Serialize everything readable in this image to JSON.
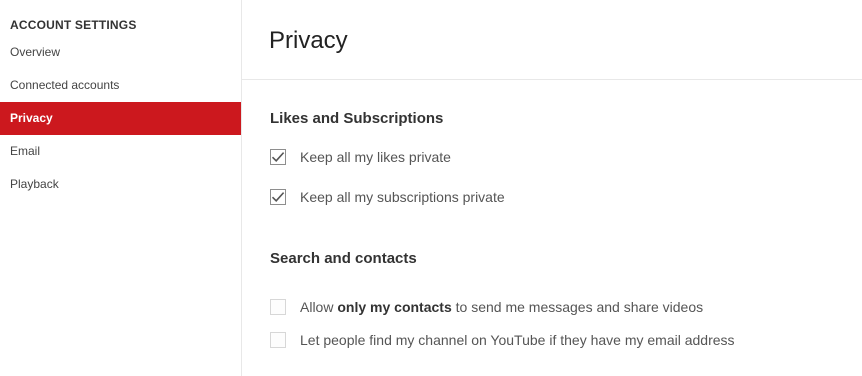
{
  "sidebar": {
    "heading": "ACCOUNT SETTINGS",
    "items": [
      {
        "label": "Overview",
        "active": false
      },
      {
        "label": "Connected accounts",
        "active": false
      },
      {
        "label": "Privacy",
        "active": true
      },
      {
        "label": "Email",
        "active": false
      },
      {
        "label": "Playback",
        "active": false
      }
    ]
  },
  "main": {
    "title": "Privacy",
    "sections": [
      {
        "title": "Likes and Subscriptions",
        "options": [
          {
            "label": "Keep all my likes private",
            "checked": true
          },
          {
            "label": "Keep all my subscriptions private",
            "checked": true
          }
        ]
      },
      {
        "title": "Search and contacts",
        "options": [
          {
            "label_before": "Allow ",
            "label_strong": "only my contacts",
            "label_after": " to send me messages and share videos",
            "checked": false
          },
          {
            "label": "Let people find my channel on YouTube if they have my email address",
            "checked": false
          }
        ]
      }
    ]
  },
  "colors": {
    "accent": "#cc181e",
    "divider": "#e8e8e8"
  },
  "icons": {
    "checked": "checkmark-icon"
  }
}
